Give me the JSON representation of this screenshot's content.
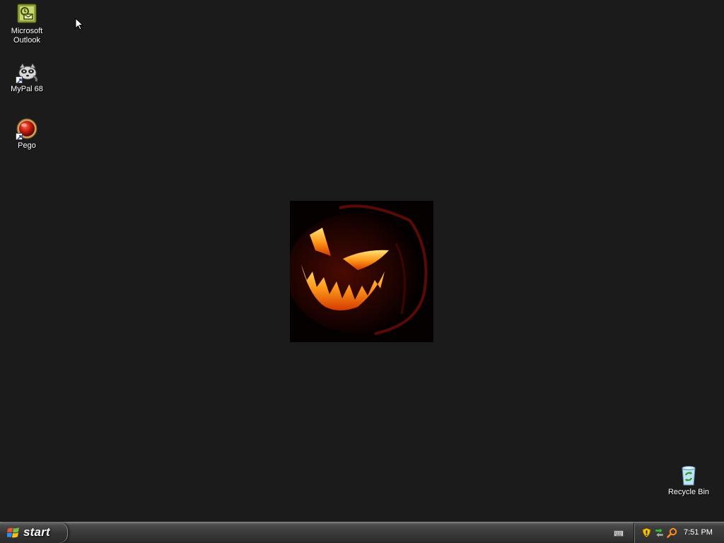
{
  "desktop": {
    "background_color": "#1b1b1b",
    "icons": [
      {
        "label": "Microsoft Outlook",
        "icon": "outlook-icon"
      },
      {
        "label": "MyPal 68",
        "icon": "mypal-icon"
      },
      {
        "label": "Pego",
        "icon": "pego-icon"
      },
      {
        "label": "Recycle Bin",
        "icon": "recycle-bin-icon"
      }
    ],
    "wallpaper": {
      "subject": "jack-o-lantern"
    }
  },
  "taskbar": {
    "start_label": "start",
    "quick_launch": [
      {
        "icon": "keyboard-icon"
      }
    ],
    "tray": {
      "icons": [
        "security-shield-icon",
        "network-icon",
        "search-magnifier-icon"
      ],
      "clock": "7:51 PM"
    }
  }
}
